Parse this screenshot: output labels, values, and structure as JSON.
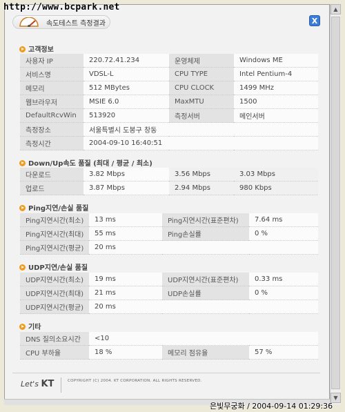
{
  "watermark": "http://www.bcpark.net",
  "header": {
    "title": "속도테스트 측정결과",
    "close": "X"
  },
  "customer": {
    "title": "고객정보",
    "rows": [
      [
        "사용자 IP",
        "220.72.41.234",
        "운영체제",
        "Windows ME"
      ],
      [
        "서비스명",
        "VDSL-L",
        "CPU TYPE",
        "Intel Pentium-4"
      ],
      [
        "메모리",
        "512 MBytes",
        "CPU CLOCK",
        "1499 MHz"
      ],
      [
        "웹브라우저",
        "MSIE 6.0",
        "MaxMTU",
        "1500"
      ],
      [
        "DefaultRcvWin",
        "513920",
        "측정서버",
        "메인서버"
      ]
    ],
    "place_label": "측정장소",
    "place_value": "서울특별시 도봉구 창동",
    "time_label": "측정시간",
    "time_value": "2004-09-10 16:40:51"
  },
  "speed": {
    "title": "Down/Up속도 품질 (최대 / 평균 / 최소)",
    "rows": [
      [
        "다운로드",
        "3.82 Mbps",
        "3.56 Mbps",
        "3.03 Mbps"
      ],
      [
        "업로드",
        "3.87 Mbps",
        "2.94 Mbps",
        "980 Kbps"
      ]
    ]
  },
  "ping": {
    "title": "Ping지연/손실 품질",
    "rows": [
      [
        "Ping지연시간(최소)",
        "13 ms",
        "Ping지연시간(표준편차)",
        "7.64 ms"
      ],
      [
        "Ping지연시간(최대)",
        "55 ms",
        "Ping손실률",
        "0 %"
      ]
    ],
    "avg_label": "Ping지연시간(평균)",
    "avg_value": "20 ms"
  },
  "udp": {
    "title": "UDP지연/손실 품질",
    "rows": [
      [
        "UDP지연시간(최소)",
        "19 ms",
        "UDP지연시간(표준편차)",
        "0.33 ms"
      ],
      [
        "UDP지연시간(최대)",
        "21 ms",
        "UDP손실률",
        "0 %"
      ]
    ],
    "avg_label": "UDP지연시간(평균)",
    "avg_value": "20 ms"
  },
  "etc": {
    "title": "기타",
    "dns_label": "DNS 질의소요시간",
    "dns_value": "<10",
    "cpu_label": "CPU 부하율",
    "cpu_value": "18 %",
    "mem_label": "메모리 점유율",
    "mem_value": "57 %"
  },
  "footer": {
    "logo_prefix": "Let's",
    "logo": "KT",
    "copyright": "COPYRIGHT (C) 2004. KT CORPORATION. ALL RIGHTS RESERVED."
  },
  "stamp": "은빛무궁화 / 2004-09-14 01:29:36",
  "colors": {
    "accent": "#f29a1a",
    "close": "#3d7dd8"
  }
}
